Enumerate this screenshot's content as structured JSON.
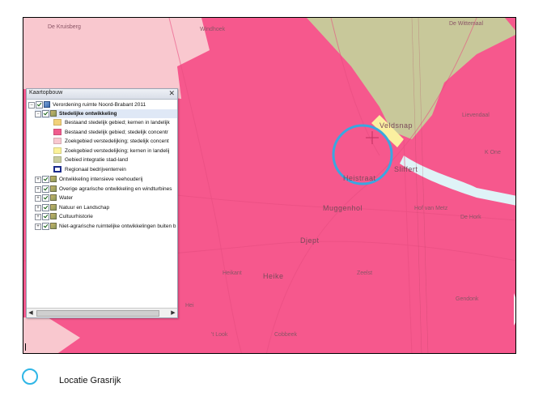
{
  "map": {
    "place_labels": {
      "de_kruisberg": "De Kruisberg",
      "windhoek": "Windhoek",
      "de_wittemaal": "De Wittemaal",
      "veldsnap": "Veldsnap",
      "lievendaal": "Lievendaal",
      "heistraat": "Heistraat",
      "sliffert": "Sliffert",
      "muggenhol": "Muggenhol",
      "hof_van_metz": "Hof van Metz",
      "de_hork": "De Hork",
      "djept": "Djept",
      "heike": "Heike",
      "heikant": "Heikant",
      "zeelst": "Zeelst",
      "gendonk": "Gendonk",
      "t_look": "'t Look",
      "cobbeek": "Cobbeek",
      "hei": "Hei",
      "kone": "K One"
    },
    "colors": {
      "pink": "#f6588d",
      "light_pink": "#f9c8cf",
      "olive": "#c8c89a",
      "marker": "#3aa7e0"
    }
  },
  "toc": {
    "title": "Kaartopbouw",
    "close_icon": "close-icon",
    "root": "Verordening ruimte Noord-Brabant 2011",
    "group": "Stedelijke ontwikkeling",
    "legend_items": [
      {
        "label": "Bestaand stedelijk gebied; kernen in landelijk",
        "color": "#f2d17a"
      },
      {
        "label": "Bestaand stedelijk gebied; stedelijk concentr",
        "color": "#f05c8e"
      },
      {
        "label": "Zoekgebied verstedelijking; stedelijk concent",
        "color": "#f9c8d0"
      },
      {
        "label": "Zoekgebied verstedelijking; kernen in landelij",
        "color": "#fbf29a"
      },
      {
        "label": "Gebied integratie stad-land",
        "color": "#c8cc9e"
      },
      {
        "label": "Regionaal bedrijventerrein",
        "color": "#ffffff"
      }
    ],
    "other_layers": [
      "Ontwikkeling intensieve veehouderij",
      "Overige agrarische ontwikkeling en windturbines",
      "Water",
      "Natuur en Landschap",
      "Cultuurhistorie",
      "Niet-agrarische ruimtelijke ontwikkelingen buiten b"
    ],
    "scroll_left": "◀",
    "scroll_right": "▶"
  },
  "legend": {
    "label": "Locatie Grasrijk"
  }
}
